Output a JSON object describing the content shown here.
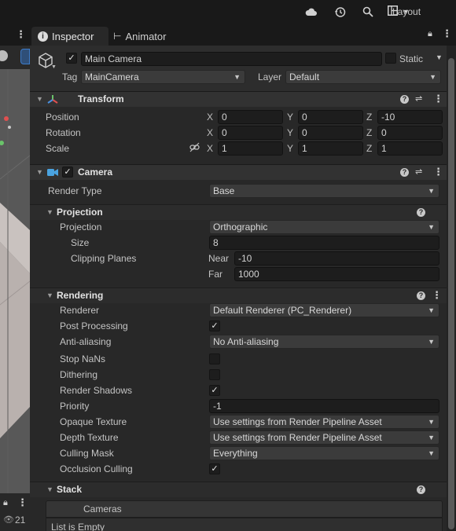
{
  "toolbar": {
    "layout_label": "Layout",
    "icons": [
      "cloud-icon",
      "history-icon",
      "search-icon",
      "layout-icon"
    ]
  },
  "left_panel": {
    "count": "21"
  },
  "tabs": [
    {
      "label": "Inspector",
      "icon": "info-icon",
      "active": true
    },
    {
      "label": "Animator",
      "icon": "animator-icon",
      "active": false
    }
  ],
  "object": {
    "name": "Main Camera",
    "enabled": true,
    "static_label": "Static",
    "static_checked": false,
    "tag_label": "Tag",
    "tag_value": "MainCamera",
    "layer_label": "Layer",
    "layer_value": "Default"
  },
  "transform": {
    "title": "Transform",
    "rows": [
      {
        "label": "Position",
        "x": "0",
        "y": "0",
        "z": "-10"
      },
      {
        "label": "Rotation",
        "x": "0",
        "y": "0",
        "z": "0"
      },
      {
        "label": "Scale",
        "x": "1",
        "y": "1",
        "z": "1"
      }
    ],
    "axes": [
      "X",
      "Y",
      "Z"
    ]
  },
  "camera": {
    "title": "Camera",
    "enabled": true,
    "render_type_label": "Render Type",
    "render_type_value": "Base",
    "projection_section": "Projection",
    "projection_label": "Projection",
    "projection_value": "Orthographic",
    "size_label": "Size",
    "size_value": "8",
    "clipping_label": "Clipping Planes",
    "near_label": "Near",
    "near_value": "-10",
    "far_label": "Far",
    "far_value": "1000",
    "rendering_section": "Rendering",
    "renderer_label": "Renderer",
    "renderer_value": "Default Renderer (PC_Renderer)",
    "post_processing_label": "Post Processing",
    "post_processing": true,
    "anti_aliasing_label": "Anti-aliasing",
    "anti_aliasing_value": "No Anti-aliasing",
    "stop_nans_label": "Stop NaNs",
    "stop_nans": false,
    "dithering_label": "Dithering",
    "dithering": false,
    "render_shadows_label": "Render Shadows",
    "render_shadows": true,
    "priority_label": "Priority",
    "priority_value": "-1",
    "opaque_texture_label": "Opaque Texture",
    "opaque_texture_value": "Use settings from Render Pipeline Asset",
    "depth_texture_label": "Depth Texture",
    "depth_texture_value": "Use settings from Render Pipeline Asset",
    "culling_mask_label": "Culling Mask",
    "culling_mask_value": "Everything",
    "occlusion_culling_label": "Occlusion Culling",
    "occlusion_culling": true,
    "stack_section": "Stack",
    "cameras_label": "Cameras",
    "list_empty_text": "List is Empty"
  },
  "colors": {
    "background": "#282828",
    "header_band": "#323232",
    "field_bg": "#1d1d1d",
    "dropdown_bg": "#3b3b3b",
    "camera_icon": "#4aa3e0"
  }
}
